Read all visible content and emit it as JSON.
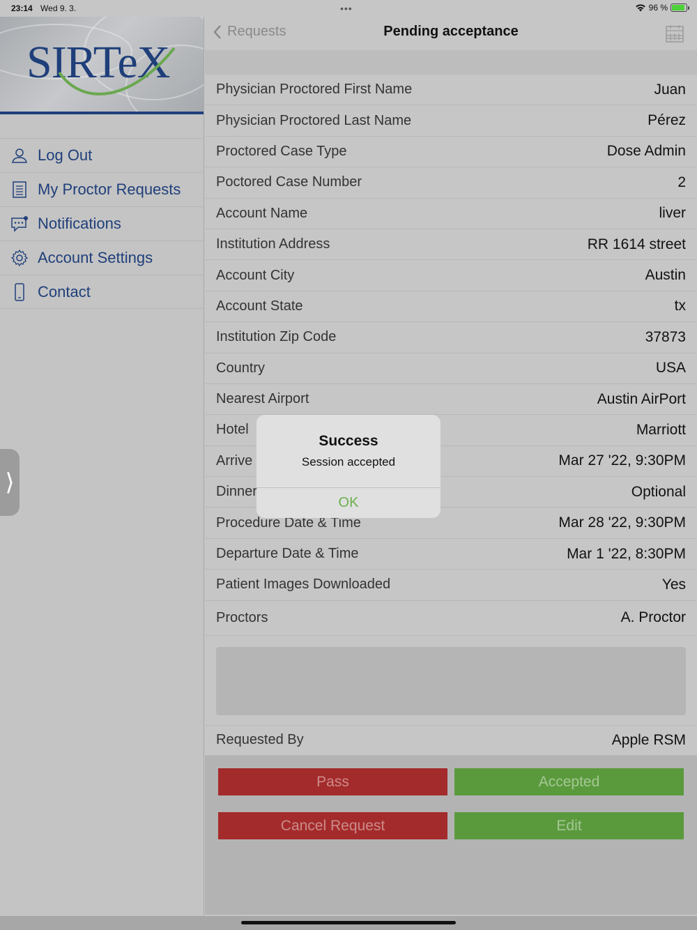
{
  "status_bar": {
    "time": "23:14",
    "date": "Wed 9. 3.",
    "battery": "96 %"
  },
  "sidebar": {
    "logo": "SIRTeX",
    "items": [
      {
        "label": "Log Out",
        "icon": "person-icon"
      },
      {
        "label": "My Proctor Requests",
        "icon": "list-icon"
      },
      {
        "label": "Notifications",
        "icon": "chat-bubble-icon"
      },
      {
        "label": "Account Settings",
        "icon": "gear-icon"
      },
      {
        "label": "Contact",
        "icon": "phone-icon"
      }
    ]
  },
  "nav": {
    "back_label": "Requests",
    "title": "Pending acceptance"
  },
  "details": [
    {
      "label": "Physician Proctored First Name",
      "value": "Juan"
    },
    {
      "label": "Physician Proctored Last Name",
      "value": "Pérez"
    },
    {
      "label": "Proctored Case Type",
      "value": "Dose Admin"
    },
    {
      "label": "Poctored Case Number",
      "value": "2"
    },
    {
      "label": "Account Name",
      "value": "liver"
    },
    {
      "label": "Institution Address",
      "value": "RR 1614 street"
    },
    {
      "label": "Account City",
      "value": "Austin"
    },
    {
      "label": "Account State",
      "value": "tx"
    },
    {
      "label": "Institution Zip Code",
      "value": "37873"
    },
    {
      "label": "Country",
      "value": "USA"
    },
    {
      "label": "Nearest Airport",
      "value": "Austin AirPort"
    },
    {
      "label": "Hotel",
      "value": "Marriott"
    },
    {
      "label": "Arrive",
      "value": "Mar 27 '22, 9:30PM"
    },
    {
      "label": "Dinner",
      "value": "Optional"
    },
    {
      "label": "Procedure Date & Time",
      "value": "Mar 28 '22, 9:30PM"
    },
    {
      "label": "Departure Date & Time",
      "value": "Mar 1 '22, 8:30PM"
    },
    {
      "label": "Patient Images Downloaded",
      "value": "Yes"
    },
    {
      "label": "Proctors",
      "value": "A. Proctor"
    }
  ],
  "requested_by": {
    "label": "Requested By",
    "value": "Apple RSM"
  },
  "buttons": {
    "pass": "Pass",
    "accepted": "Accepted",
    "cancel_request": "Cancel Request",
    "edit": "Edit"
  },
  "alert": {
    "title": "Success",
    "message": "Session accepted",
    "ok": "OK"
  },
  "colors": {
    "brand_blue": "#1f3f7a",
    "red_button": "#a42b2b",
    "green_button": "#5a9a3d",
    "ok_green": "#6ab04c"
  }
}
